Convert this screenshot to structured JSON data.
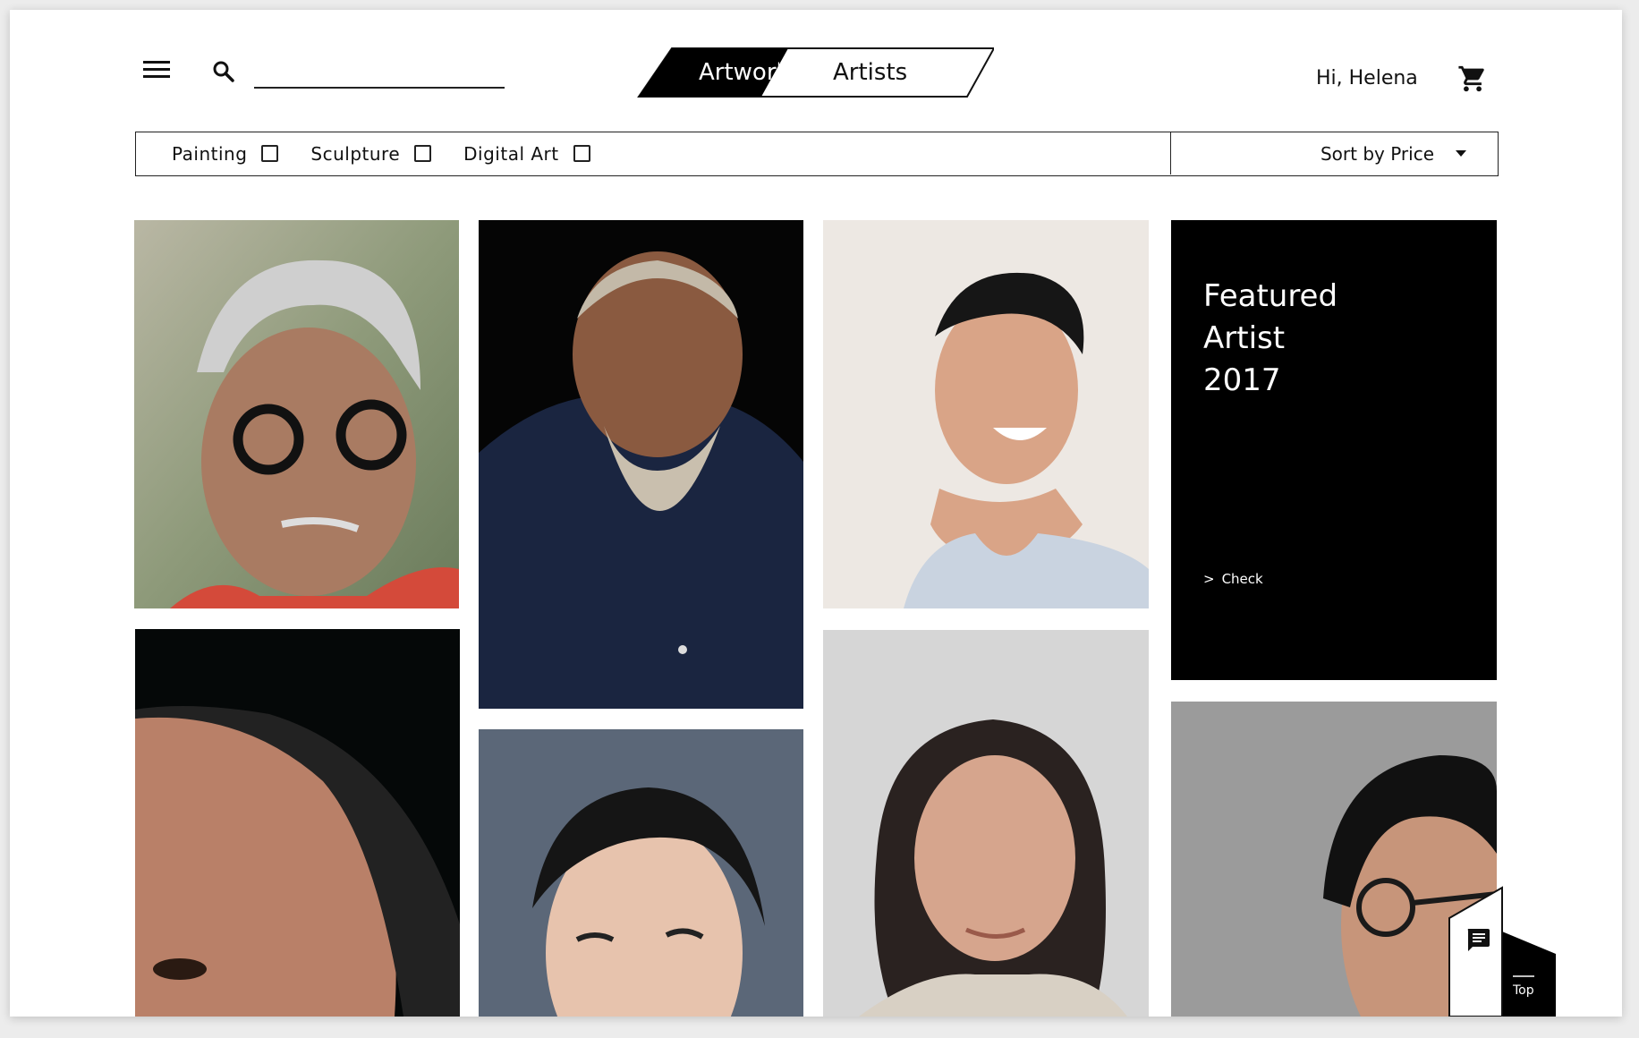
{
  "header": {
    "search_placeholder": "",
    "toggle": {
      "active": "Artworks",
      "inactive": "Artists"
    },
    "greeting": "Hi, Helena"
  },
  "filters": {
    "categories": [
      "Painting",
      "Sculpture",
      "Digital Art"
    ],
    "sort_label": "Sort by Price"
  },
  "featured": {
    "line1": "Featured",
    "line2": "Artist",
    "line3": "2017",
    "link": "Check"
  },
  "floating": {
    "top_label": "Top"
  },
  "colors": {
    "accent": "#000000",
    "background": "#ffffff"
  },
  "icons": [
    "menu-icon",
    "search-icon",
    "cart-icon",
    "checkbox-icon",
    "caret-down-icon",
    "chat-icon"
  ]
}
